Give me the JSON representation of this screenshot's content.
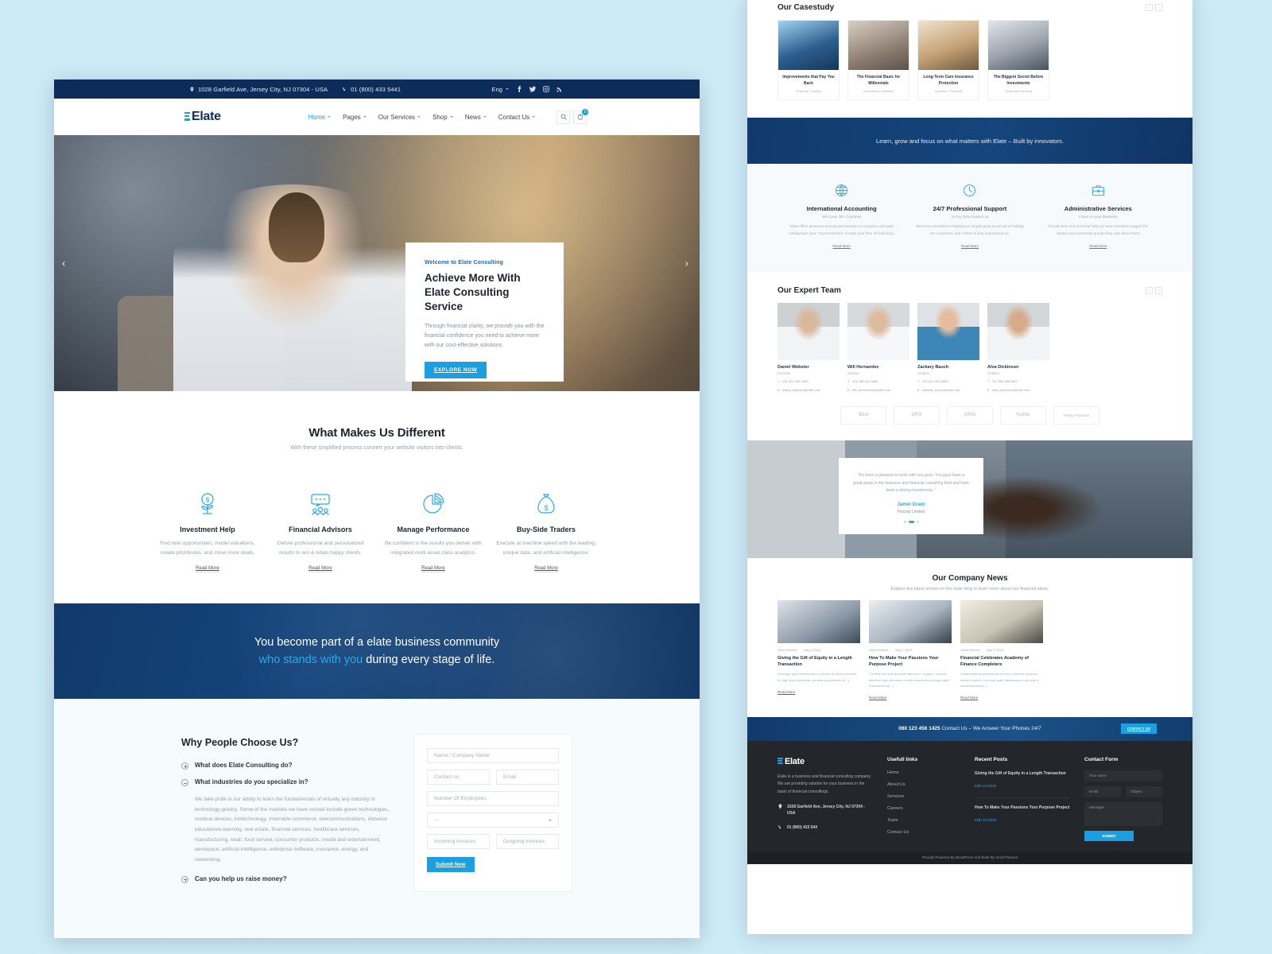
{
  "topbar": {
    "address": "1028 Garfield Ave, Jersey City, NJ 07304 - USA",
    "phone": "01 (800) 433 5441",
    "language": "Eng",
    "socials": [
      "facebook-icon",
      "twitter-icon",
      "instagram-icon",
      "rss-icon"
    ]
  },
  "brand": {
    "name": "Elate"
  },
  "nav": {
    "items": [
      {
        "label": "Home",
        "active": true
      },
      {
        "label": "Pages",
        "active": false
      },
      {
        "label": "Our Services",
        "active": false
      },
      {
        "label": "Shop",
        "active": false
      },
      {
        "label": "News",
        "active": false
      },
      {
        "label": "Contact Us",
        "active": false
      }
    ],
    "cart_count": "0"
  },
  "hero": {
    "eyebrow": "Welcome to Elate Consulting",
    "title": "Achieve More With Elate Consulting Service",
    "desc": "Through financial clarity, we provide you with the financial confidence you need to achieve more with our cost-effective solutions.",
    "button": "EXPLORE NOW",
    "prev": "‹",
    "next": "›"
  },
  "features": {
    "title": "What Makes Us Different",
    "subtitle": "With these simplified process convert your website visitors into clients.",
    "read_more": "Read More",
    "items": [
      {
        "icon": "money-plant-icon",
        "title": "Investment Help",
        "desc": "Find new opportunities, model valuations, create pitchbooks, and close more deals."
      },
      {
        "icon": "advisors-icon",
        "title": "Financial Advisors",
        "desc": "Deliver professional and personalized results to win & retain happy clients."
      },
      {
        "icon": "pie-chart-icon",
        "title": "Manage Performance",
        "desc": "Be confident in the results you deliver with integrated multi-asset class analytics."
      },
      {
        "icon": "money-bag-icon",
        "title": "Buy-Side Traders",
        "desc": "Execute at machine speed with the leading, unique data, and artificial intelligence."
      }
    ]
  },
  "band": {
    "line1": "You become part of a elate business community",
    "highlight": "who stands with you",
    "line2_rest": " during every stage of life."
  },
  "faq": {
    "title": "Why People Choose Us?",
    "items": [
      {
        "q": "What does Elate Consulting do?",
        "open": false,
        "a": ""
      },
      {
        "q": "What industries do you specialize in?",
        "open": true,
        "a": "We take pride in our ability to learn the fundamentals of virtually any industry or technology quickly. Some of the markets we have served include green technologies, medical devices, biotechnology, Internet/e-commerce, telecommunications, distance education/e-learning, real estate, financial services, healthcare services, manufacturing, retail, food service, consumer products, media and entertainment, aerospace, artificial intelligence, enterprise software, insurance, energy, and networking."
      },
      {
        "q": "Can you help us raise money?",
        "open": false,
        "a": ""
      }
    ]
  },
  "quote_form": {
    "name_placeholder": "Name / Company Name",
    "contact_placeholder": "Contact no",
    "email_placeholder": "Email",
    "employees_placeholder": "Number Of Employees",
    "select_value": "---",
    "incoming_placeholder": "Incoming Invoices",
    "outgoing_placeholder": "Outgoing Invoices",
    "submit": "Submit Now"
  },
  "casestudy": {
    "title": "Our Casestudy",
    "items": [
      {
        "title": "Improvements that Pay You Back",
        "tags": "Financial, Trading"
      },
      {
        "title": "The Financial Basic for Millennials",
        "tags": "Accounting, Cashflow"
      },
      {
        "title": "Long-Term Care Insurance Protection",
        "tags": "Cashflow, Financial"
      },
      {
        "title": "The Biggest Secret Before Investments",
        "tags": "Financial, Invoicing"
      }
    ]
  },
  "promo_band": {
    "text": "Learn, grow and focus on what matters with Elate – Built by innovators."
  },
  "services": {
    "read_more": "Read More",
    "items": [
      {
        "icon": "globe-icon",
        "title": "International Accounting",
        "tag": "We Cover 30+ Countries",
        "desc": "Elate offers generous annual paid vacation accrual plus nine paid holidays per year. You've earned it, so take your time off and enjoy."
      },
      {
        "icon": "clock-icon",
        "title": "24/7 Professional Support",
        "tag": "At Any Time Contact us",
        "desc": "We're as committed to helping our people grow as we are to helping our customers. Our culture is very important to us."
      },
      {
        "icon": "briefcase-icon",
        "title": "Administrative Services",
        "tag": "Focus on your Business",
        "desc": "Provide time and tools that help our team members support the causes and community groups they care about most."
      }
    ]
  },
  "team": {
    "title": "Our Expert Team",
    "members": [
      {
        "name": "Daniel Webster",
        "role": "Founder",
        "phone": "T : 125-325-365-1845",
        "email": "E : daniel_webster@elate.com"
      },
      {
        "name": "Will Hernandez",
        "role": "Advisor",
        "phone": "T : 124-458-521-4896",
        "email": "E : will_hernandez@elate.com"
      },
      {
        "name": "Zackary Bauch",
        "role": "Analyst",
        "phone": "T : 745-512-154-8963",
        "email": "E : zackary_bauch@elate.com"
      },
      {
        "name": "Alva Dickinson",
        "role": "Analyst",
        "phone": "T : 147-586-548-5697",
        "email": "E : alva_dickinson@elate.com"
      }
    ]
  },
  "brands": [
    {
      "name": "Bird"
    },
    {
      "name": "SPO"
    },
    {
      "name": "ARIA"
    },
    {
      "name": "Kathe"
    },
    {
      "name": "Pretty Pistache"
    }
  ],
  "testimonial": {
    "quote": "\"It's been a pleasure to work with you guys. You guys have a great grasp in the business and financial consulting field and have been a strong investments. \"",
    "name": "Jamel Grant",
    "company": "Fincorp Limited"
  },
  "news": {
    "title": "Our Company News",
    "subtitle": "Explore the latest stories on the elate blog to learn more about our financial ideas.",
    "read_more": "Read More",
    "items": [
      {
        "author": "VictorThemes",
        "date": "July 2, 2019",
        "title": "Giving the Gift of Equity in a Length Transaction",
        "excerpt": "Leverage agile frameworks to provide a robust synopsis for high level overviews, Iterative approaches to[...]"
      },
      {
        "author": "VictorThemes",
        "date": "July 2, 2019",
        "title": "How To Make Your Passions Your Purpose Project",
        "excerpt": "Credibly innovate granular internal or \"organic\" sources whereas high standards in web-readiness.Leverage agile frameworks to[...]"
      },
      {
        "author": "VictorThemes",
        "date": "July 2, 2019",
        "title": "Financial Celebrates Academy of Finance Completers",
        "excerpt": "Collaboratively administrate turnkey channels whereas virtual e-tailers. Leverage agile frameworks to provide a robust synopsis[...]"
      }
    ]
  },
  "cta": {
    "phone": "080 123 456 1425",
    "text": " Contact Us – We Answer Your Phones 24/7",
    "button": "CONTACT US"
  },
  "footer": {
    "about": "Elate is a business and financial consulting company. We are providing solution for your business in the basis of financial consultings.",
    "address": "1028 Garfield Ave, Jersey City, NJ 07304 - USA",
    "phone": "01 (800) 433 544",
    "useful_links_title": "Usefull links",
    "links": [
      "Home",
      "About Us",
      "Services",
      "Careers",
      "Team",
      "Contact Us"
    ],
    "recent_title": "Recent Posts",
    "recent": [
      {
        "title": "Giving the Gift of Equity in a Length Transaction",
        "date": "02th Jul 2019"
      },
      {
        "title": "How To Make Your Passions Your Purpose Project",
        "date": "02th Jul 2019"
      }
    ],
    "contact_title": "Contact Form",
    "name_placeholder": "Your name",
    "email_placeholder": "Email",
    "subject_placeholder": "Subject",
    "message_placeholder": "Message",
    "submit": "SUBMIT",
    "copyright": "Proudly Powered By WordPress And Elate By VictorThemes"
  },
  "colors": {
    "accent": "#1b9fe0",
    "navy": "#0c2d5a",
    "dark": "#23272c"
  }
}
